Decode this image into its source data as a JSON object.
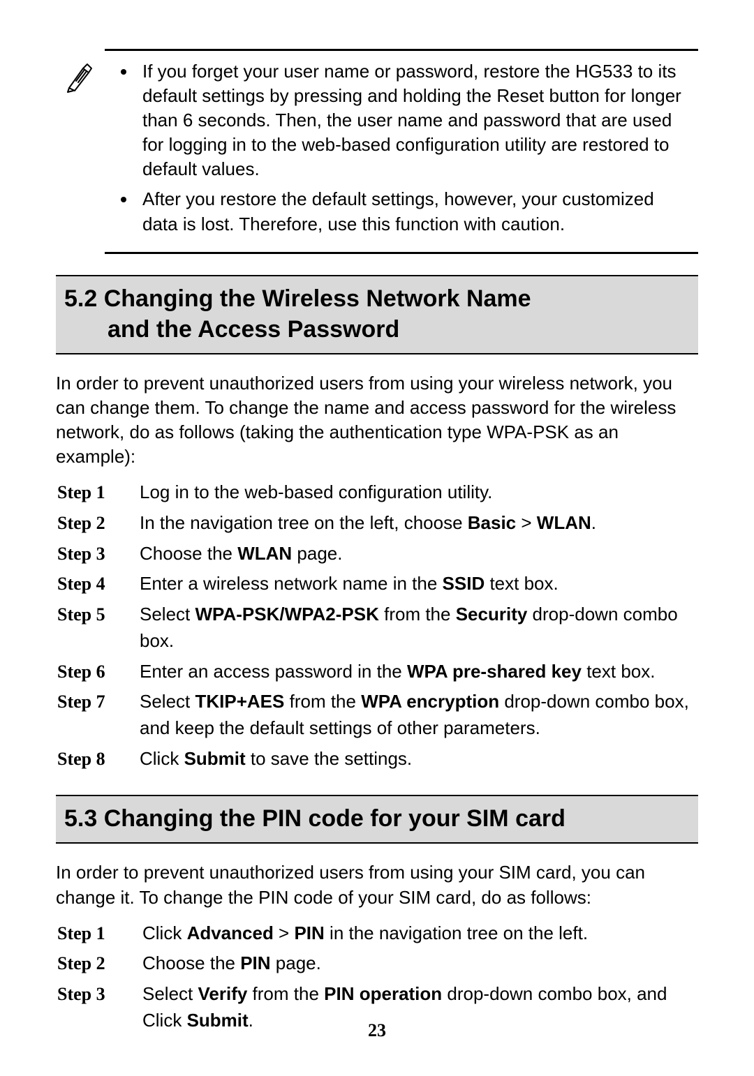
{
  "note": {
    "bullets": [
      "If you forget your user name or password, restore the HG533 to its default settings by pressing and holding the Reset button for longer than 6 seconds. Then, the user name and password that are used for logging in to the web-based configuration utility are restored to default values.",
      "After you restore the default settings, however, your customized data is lost. Therefore, use this function with caution."
    ]
  },
  "section52": {
    "heading_line1": "5.2 Changing the Wireless Network Name",
    "heading_line2": "and the Access Password",
    "intro": "In order to prevent unauthorized users from using your wireless network, you can change them. To change the name and access password for the wireless network, do as follows (taking the authentication type WPA-PSK as an example):",
    "steps": [
      {
        "label": "Step 1",
        "html": "Log in to the web-based configuration utility."
      },
      {
        "label": "Step 2",
        "html": "In the navigation tree on the left, choose <b>Basic</b> > <b>WLAN</b>."
      },
      {
        "label": "Step 3",
        "html": "Choose the <b>WLAN</b> page."
      },
      {
        "label": "Step 4",
        "html": "Enter a wireless network name in the <b>SSID</b> text box."
      },
      {
        "label": "Step 5",
        "html": "Select <b>WPA-PSK/WPA2-PSK</b> from the <b>Security</b> drop-down combo box."
      },
      {
        "label": "Step 6",
        "html": "Enter an access password in the <b>WPA pre-shared key</b> text box."
      },
      {
        "label": "Step 7",
        "html": "Select <b>TKIP+AES</b> from the <b>WPA encryption</b> drop-down combo box, and keep the default settings of other parameters."
      },
      {
        "label": "Step 8",
        "html": "Click <b>Submit</b> to save the settings."
      }
    ]
  },
  "section53": {
    "heading": "5.3 Changing the PIN code for your SIM card",
    "intro": "In order to prevent unauthorized users from using your SIM card, you can change it. To change the PIN code of your SIM card, do as follows:",
    "steps": [
      {
        "label": "Step 1",
        "html": "Click <b>Advanced</b> > <b>PIN</b> in the navigation tree on the left."
      },
      {
        "label": "Step 2",
        "html": "Choose the <b>PIN</b> page."
      },
      {
        "label": "Step 3",
        "html": "Select <b>Verify</b> from the <b>PIN operation</b> drop-down combo box, and Click <b>Submit</b>."
      }
    ]
  },
  "page_number": "23"
}
